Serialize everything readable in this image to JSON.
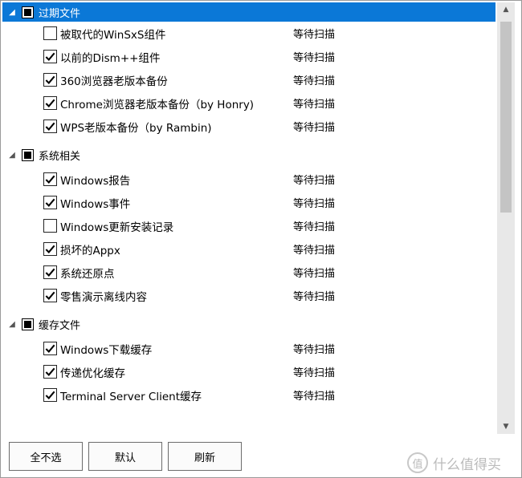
{
  "groups": [
    {
      "title": "过期文件",
      "items": [
        {
          "label": "被取代的WinSxS组件",
          "status": "等待扫描",
          "checked": false
        },
        {
          "label": "以前的Dism++组件",
          "status": "等待扫描",
          "checked": true
        },
        {
          "label": "360浏览器老版本备份",
          "status": "等待扫描",
          "checked": true
        },
        {
          "label": "Chrome浏览器老版本备份（by Honry)",
          "status": "等待扫描",
          "checked": true
        },
        {
          "label": "WPS老版本备份（by Rambin)",
          "status": "等待扫描",
          "checked": true
        }
      ]
    },
    {
      "title": "系统相关",
      "items": [
        {
          "label": "Windows报告",
          "status": "等待扫描",
          "checked": true
        },
        {
          "label": "Windows事件",
          "status": "等待扫描",
          "checked": true
        },
        {
          "label": "Windows更新安装记录",
          "status": "等待扫描",
          "checked": false
        },
        {
          "label": "损坏的Appx",
          "status": "等待扫描",
          "checked": true
        },
        {
          "label": "系统还原点",
          "status": "等待扫描",
          "checked": true
        },
        {
          "label": "零售演示离线内容",
          "status": "等待扫描",
          "checked": true
        }
      ]
    },
    {
      "title": "缓存文件",
      "items": [
        {
          "label": "Windows下载缓存",
          "status": "等待扫描",
          "checked": true
        },
        {
          "label": "传递优化缓存",
          "status": "等待扫描",
          "checked": true
        },
        {
          "label": "Terminal Server Client缓存",
          "status": "等待扫描",
          "checked": true
        }
      ]
    }
  ],
  "buttons": {
    "none": "全不选",
    "default": "默认",
    "refresh": "刷新"
  },
  "watermark": {
    "logo": "值",
    "text": "什么值得买"
  },
  "colors": {
    "selected_header": "#0b78d7",
    "scrollbar_track": "#e8e8e8",
    "scrollbar_thumb": "#c4c4c4"
  }
}
